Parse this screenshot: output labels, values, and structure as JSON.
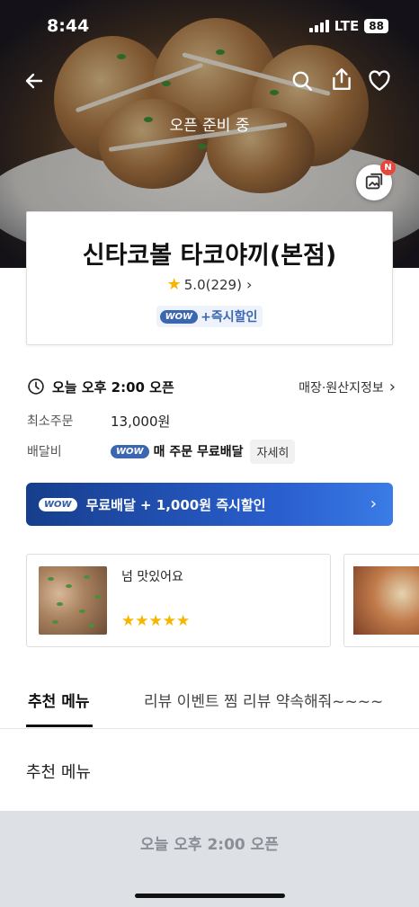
{
  "status_bar": {
    "time": "8:44",
    "network": "LTE",
    "battery": "88"
  },
  "hero": {
    "open_status": "오픈 준비 중",
    "photo_badge": "N"
  },
  "store": {
    "name": "신타코볼 타코야끼(본점)",
    "rating": "5.0(229)",
    "promo_badge": "WOW",
    "promo_text": "+즉시할인"
  },
  "info": {
    "hours": "오늘 오후 2:00 오픈",
    "origin_link": "매장·원산지정보",
    "min_order_label": "최소주문",
    "min_order_value": "13,000원",
    "delivery_fee_label": "배달비",
    "delivery_badge": "WOW",
    "delivery_text": "매 주문 무료배달",
    "detail_button": "자세히"
  },
  "banner": {
    "badge": "WOW",
    "text": "무료배달 + 1,000원 즉시할인"
  },
  "reviews": [
    {
      "text": "넘 맛있어요",
      "rating": 5,
      "stars": "★★★★★"
    }
  ],
  "tabs": [
    {
      "label": "추천 메뉴",
      "active": true
    },
    {
      "label": "리뷰 이벤트 찜 리뷰 약속해줘~~~~",
      "active": false
    }
  ],
  "section": {
    "title": "추천 메뉴"
  },
  "bottom_bar": {
    "text": "오늘 오후 2:00 오픈"
  },
  "colors": {
    "accent": "#3b66b0",
    "star": "#f6b600",
    "banner": "#1f4fb0",
    "badge_red": "#e8453c"
  }
}
